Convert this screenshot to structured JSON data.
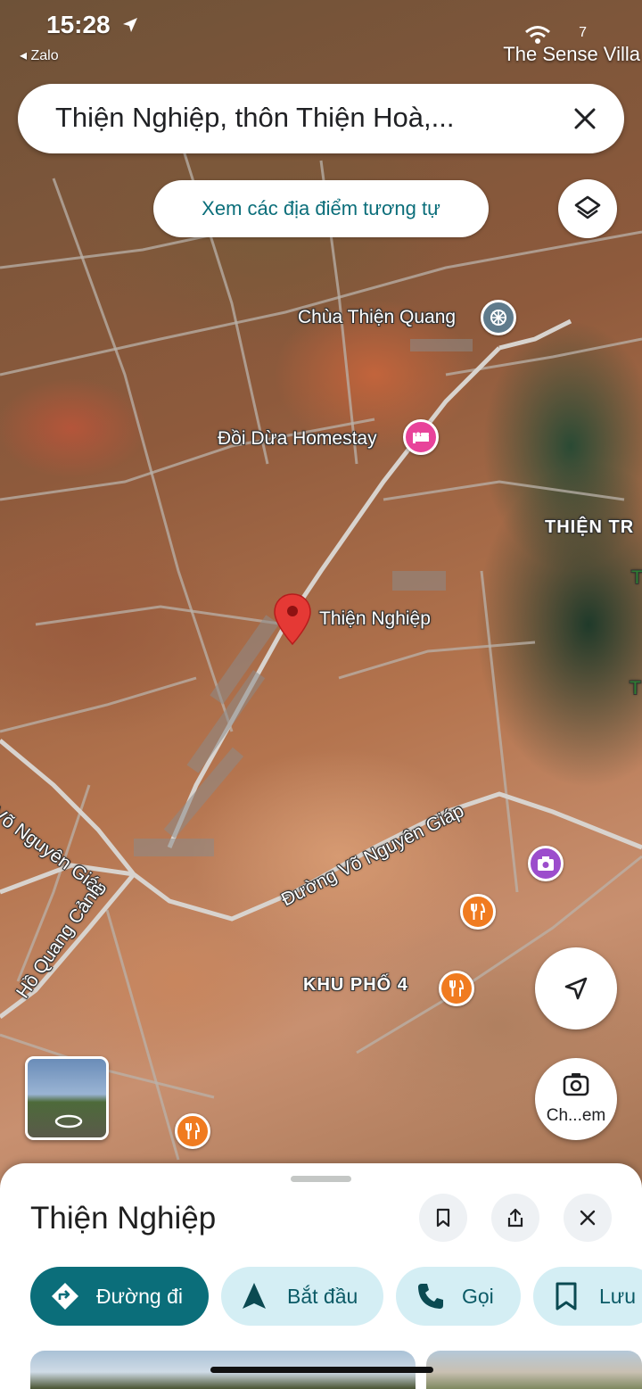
{
  "status_bar": {
    "time": "15:28",
    "back_app": "◂ Zalo",
    "signal": "7",
    "overlay_place": "The Sense Villa"
  },
  "search": {
    "query": "Thiện Nghiệp, thôn Thiện Hoà,...",
    "clear_icon": "close-icon"
  },
  "similar_places_chip": "Xem các địa điểm tương tự",
  "layers_icon": "layers-icon",
  "map": {
    "labels": {
      "temple": "Chùa Thiện Quang",
      "homestay": "Đồi Dừa Homestay",
      "selected_place": "Thiện Nghiệp",
      "area_east": "THIỆN TR",
      "road_main": "Đường Võ Nguyên Giáp",
      "road_left": "Võ Nguyên Giáp",
      "road_ho": "Hồ Quang Cảnh",
      "quarter": "KHU PHỐ 4",
      "edge_t1": "T",
      "edge_t2": "T"
    },
    "colors": {
      "pin": "#e53935",
      "hotel_poi": "#e8439a",
      "restaurant_poi": "#f07b20",
      "photo_poi": "#9c4dcc",
      "temple_poi": "#5f7b8c"
    }
  },
  "controls": {
    "navigation_icon": "navigation-arrow-icon",
    "lens_label": "Ch...em"
  },
  "sheet": {
    "title": "Thiện Nghiệp",
    "bookmark_icon": "bookmark-icon",
    "share_icon": "share-icon",
    "close_icon": "close-icon",
    "actions": [
      {
        "label": "Đường đi",
        "icon": "directions-icon"
      },
      {
        "label": "Bắt đầu",
        "icon": "start-arrow-icon"
      },
      {
        "label": "Gọi",
        "icon": "phone-icon"
      },
      {
        "label": "Lưu",
        "icon": "bookmark-icon"
      }
    ]
  }
}
